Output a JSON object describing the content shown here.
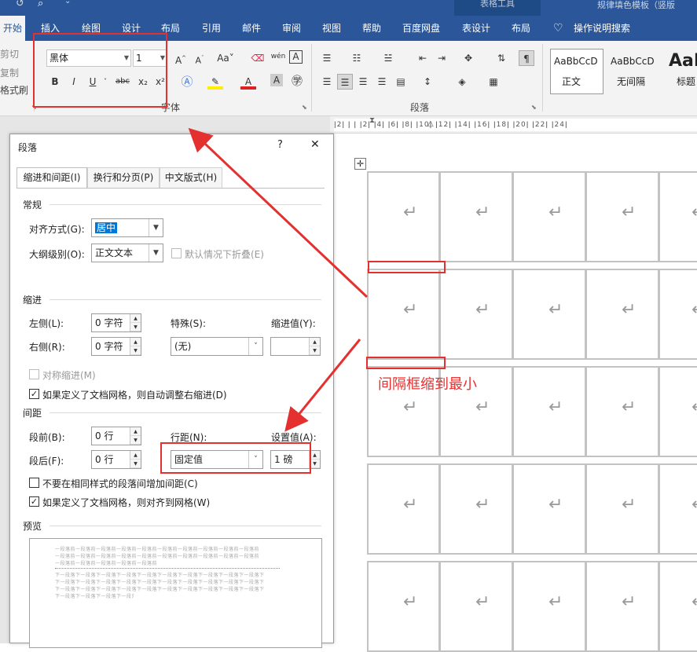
{
  "title_bar": {
    "context_tab": "表格工具",
    "doc_title": "规律填色模板（竖版"
  },
  "tabs": [
    "开始",
    "插入",
    "绘图",
    "设计",
    "布局",
    "引用",
    "邮件",
    "审阅",
    "视图",
    "帮助",
    "百度网盘",
    "表设计",
    "布局"
  ],
  "tell_me": "操作说明搜索",
  "clipboard": {
    "cut": "剪切",
    "copy": "复制",
    "format_painter": "格式刷"
  },
  "font": {
    "name": "黑体",
    "size": "1",
    "group_label": "字体",
    "bold": "B",
    "italic": "I",
    "underline": "U",
    "strike": "abc",
    "subscript": "x₂",
    "superscript": "x²",
    "grow": "A^",
    "shrink": "A˅",
    "case": "Aa",
    "wen": "wén",
    "boxA": "A"
  },
  "paragraph": {
    "group_label": "段落"
  },
  "styles": [
    {
      "sample": "AaBbCcD",
      "name": "正文"
    },
    {
      "sample": "AaBbCcD",
      "name": "无间隔"
    },
    {
      "sample": "AaB",
      "name": "标题"
    }
  ],
  "ruler": "ǀ2ǀ  ǀ ǀ ǀ2ǀ  ǀ4ǀ  ǀ6ǀ  ǀ8ǀ  ǀ10ǀ  ǀ12ǀ  ǀ14ǀ  ǀ16ǀ  ǀ18ǀ  ǀ20ǀ  ǀ22ǀ  ǀ24ǀ",
  "dialog": {
    "title": "段落",
    "help": "?",
    "close": "✕",
    "tabs": [
      "缩进和间距(I)",
      "换行和分页(P)",
      "中文版式(H)"
    ],
    "general": {
      "label": "常规",
      "align_label": "对齐方式(G):",
      "align_value": "居中",
      "outline_label": "大纲级别(O):",
      "outline_value": "正文文本",
      "collapse_label": "默认情况下折叠(E)"
    },
    "indent": {
      "label": "缩进",
      "left_label": "左侧(L):",
      "left_value": "0 字符",
      "right_label": "右侧(R):",
      "right_value": "0 字符",
      "special_label": "特殊(S):",
      "special_value": "(无)",
      "by_label": "缩进值(Y):",
      "by_value": "",
      "mirror_label": "对称缩进(M)",
      "auto_label": "如果定义了文档网格，则自动调整右缩进(D)"
    },
    "spacing": {
      "label": "间距",
      "before_label": "段前(B):",
      "before_value": "0 行",
      "after_label": "段后(F):",
      "after_value": "0 行",
      "line_label": "行距(N):",
      "line_value": "固定值",
      "at_label": "设置值(A):",
      "at_value": "1 磅",
      "nosame_label": "不要在相同样式的段落间增加间距(C)",
      "snap_label": "如果定义了文档网格，则对齐到网格(W)"
    },
    "preview": {
      "label": "预览",
      "before": "一段落前一段落前一段落前一段落前一段落前一段落前一段落前一段落前一段落前一段落前",
      "current": "下一段落下一段落下一段落下一段落下一段落下一段落下一段落下一段落下一段落下一段落下"
    }
  },
  "table": {
    "return_symbol": "↵"
  },
  "annotation": "间隔框缩到最小",
  "colors": {
    "brand": "#2b579a",
    "annotation": "#e53030",
    "selection": "#0078d7"
  }
}
